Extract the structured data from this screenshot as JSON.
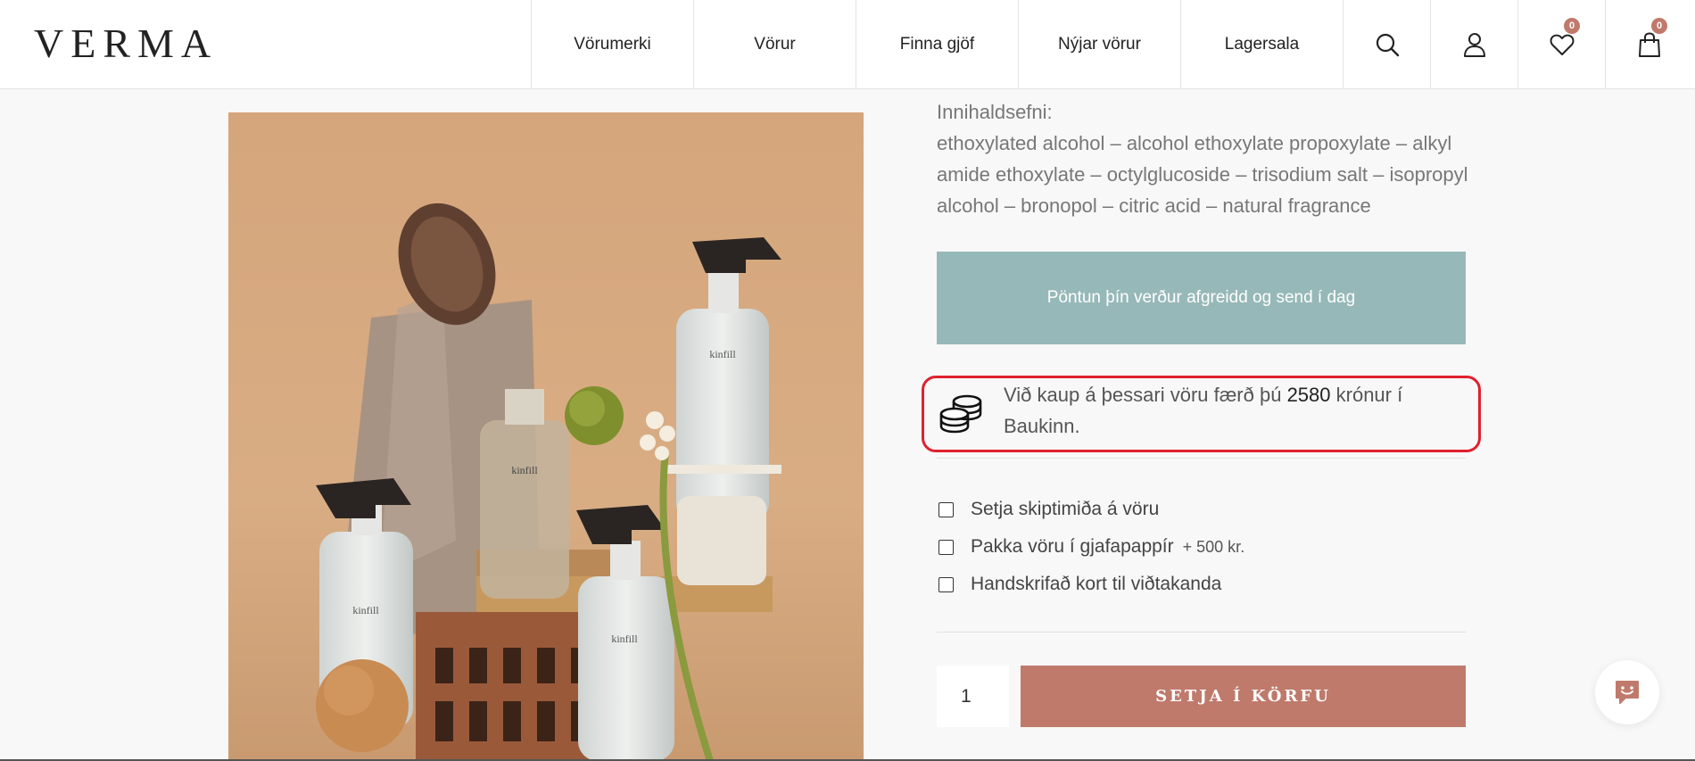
{
  "header": {
    "logo": "VERMA",
    "nav": [
      "Vörumerki",
      "Vörur",
      "Finna gjöf",
      "Nýjar vörur",
      "Lagersala"
    ],
    "wishlist_count": "0",
    "cart_count": "0"
  },
  "product": {
    "image_brand_label": "kinfill",
    "ingredients_title": "Innihaldsefni:",
    "ingredients_text": "ethoxylated alcohol – alcohol ethoxylate propoxylate – alkyl amide ethoxylate – octylglucoside – trisodium salt – isopropyl alcohol – bronopol – citric acid – natural fragrance",
    "shipping_banner": "Pöntun þín verður afgreidd og send í dag",
    "reward_prefix": "Við kaup á þessari vöru færð þú ",
    "reward_amount": "2580",
    "reward_suffix": " krónur í Baukinn.",
    "options": [
      {
        "label": "Setja skiptimiða á vöru",
        "extra": ""
      },
      {
        "label": "Pakka vöru í gjafapappír",
        "extra": "+ 500 kr."
      },
      {
        "label": "Handskrifað kort til viðtakanda",
        "extra": ""
      }
    ],
    "quantity": "1",
    "add_to_cart_label": "SETJA Í KÖRFU"
  },
  "colors": {
    "accent": "#bf7a6c",
    "banner": "#97b8b8",
    "highlight": "#e0202e"
  }
}
